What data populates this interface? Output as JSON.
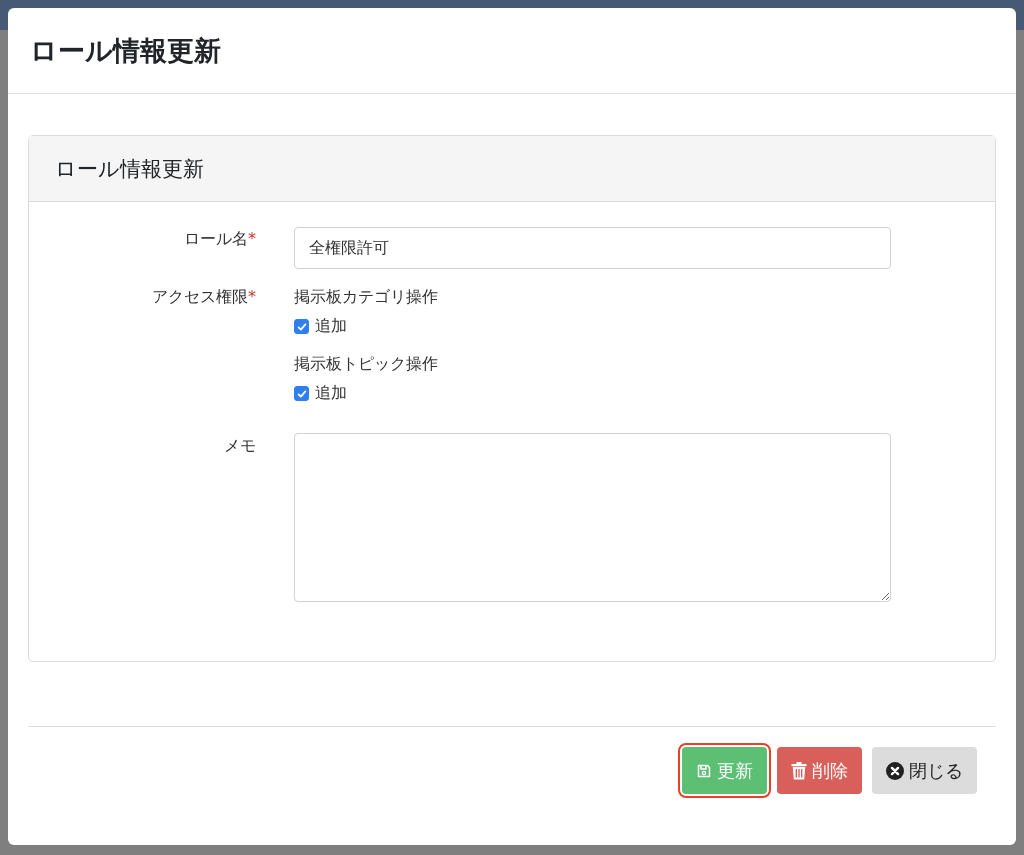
{
  "dialog": {
    "title": "ロール情報更新"
  },
  "card": {
    "title": "ロール情報更新"
  },
  "fields": [
    {
      "kind": "text",
      "label": "ロール名",
      "required_mark": "*",
      "value": "全権限許可"
    },
    {
      "kind": "permissions",
      "label": "アクセス権限",
      "required_mark": "*",
      "groups": [
        {
          "title": "掲示板カテゴリ操作",
          "options": [
            {
              "label": "追加",
              "checked": true
            }
          ]
        },
        {
          "title": "掲示板トピック操作",
          "options": [
            {
              "label": "追加",
              "checked": true
            }
          ]
        }
      ]
    },
    {
      "kind": "textarea",
      "label": "メモ"
    }
  ],
  "buttons": [
    {
      "kind": "save",
      "label": "更新",
      "highlighted": true
    },
    {
      "kind": "delete",
      "label": "削除",
      "highlighted": false
    },
    {
      "kind": "close",
      "label": "閉じる",
      "highlighted": false
    }
  ]
}
